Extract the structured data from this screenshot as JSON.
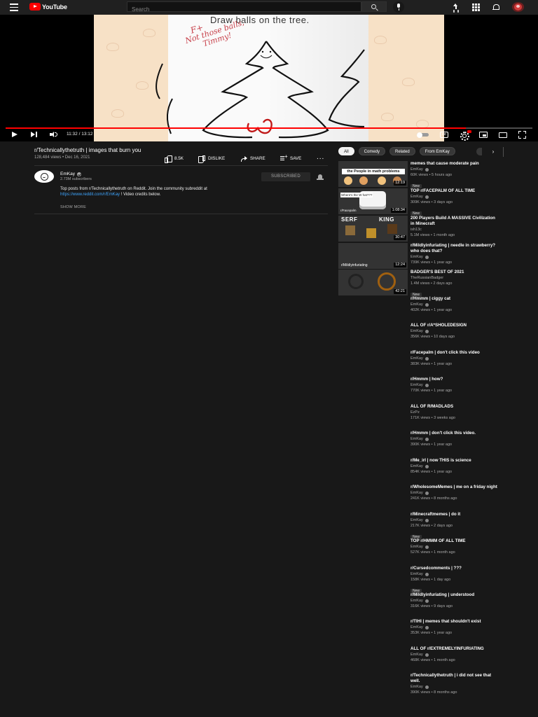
{
  "masthead": {
    "logo_text": "YouTube",
    "search_placeholder": "Search",
    "icons": [
      "menu-icon",
      "youtube-logo-icon",
      "search-icon",
      "mic-icon",
      "upload-icon",
      "apps-icon",
      "notifications-icon",
      "account-avatar"
    ]
  },
  "player": {
    "frame_caption": "Draw balls on the tree.",
    "frame_note_grade": "F+",
    "frame_note": "Not those balls, Timmy!",
    "time_display": "11:32 / 13:12",
    "progress": 0.874,
    "progress_color": "#ff0000",
    "controls": [
      "play-icon",
      "next-icon",
      "volume-icon",
      "autoplay-toggle",
      "subtitles-icon",
      "settings-icon",
      "miniplayer-icon",
      "theater-icon",
      "fullscreen-icon"
    ]
  },
  "video": {
    "title": "r/Technicallythetruth | images that burn you",
    "meta": "128,484 views • Dec 16, 2021",
    "like_count": "8.5K",
    "dislike_label": "DISLIKE",
    "share_label": "SHARE",
    "save_label": "SAVE",
    "more_label": "..."
  },
  "channel": {
    "name": "EmKay",
    "subscribers": "2.73M subscribers",
    "subscribe_label": "SUBSCRIBED",
    "description_line1": "Top posts from r/Technicallythetruth on Reddit. Join the community subreddit at",
    "description_link": "https://www.reddit.com/r/EmKay",
    "description_after_link": " ! Video credits below.",
    "show_more": "SHOW MORE"
  },
  "chips": [
    "All",
    "Comedy",
    "Related",
    "From EmKay"
  ],
  "chip_next": "›",
  "recommendations": [
    {
      "title": "memes that cause moderate pain",
      "channel": "EmKay",
      "meta": "60K views • 5 hours ago",
      "badge": "New",
      "duration": "12:19",
      "thumb_text": "the People in math problems"
    },
    {
      "title": "TOP r/FACEPALM OF ALL TIME",
      "channel": "EmKay",
      "meta": "309K views • 3 days ago",
      "badge": "New",
      "duration": "1:08:34",
      "thumb_text": "Where's the W hat???",
      "thumb_text2": "r/Facepalm"
    },
    {
      "title": "200 Players Build A MASSIVE Civilization in Minecraft",
      "channel": "ish13c",
      "meta": "5.1M views • 1 month ago",
      "badge": "",
      "duration": "30:47",
      "thumb_text": "SERF",
      "thumb_text2": "KING"
    },
    {
      "title": "r/Mildlyinfuriating | needle in strawberry? who does that?",
      "channel": "EmKay",
      "meta": "739K views • 1 year ago",
      "badge": "",
      "duration": "12:24",
      "thumb_text": "r/Mildlyinfuriating"
    },
    {
      "title": "BADGER'S BEST OF 2021",
      "channel": "TheRussianBadger",
      "meta": "1.4M views • 2 days ago",
      "badge": "New",
      "duration": "42:21"
    },
    {
      "title": "r/Hmmm | ciggy cat",
      "channel": "EmKay",
      "meta": "402K views • 1 year ago",
      "badge": ""
    },
    {
      "title": "ALL OF r/A*SHOLEDESIGN",
      "channel": "EmKay",
      "meta": "356K views • 10 days ago",
      "badge": ""
    },
    {
      "title": "r/Facepalm | don't click this video",
      "channel": "EmKay",
      "meta": "383K views • 1 year ago",
      "badge": ""
    },
    {
      "title": "r/Hmmm | how?",
      "channel": "EmKay",
      "meta": "770K views • 1 year ago",
      "badge": ""
    },
    {
      "title": "ALL OF R/MADLADS",
      "channel": "EzPz",
      "meta": "171K views • 3 weeks ago",
      "badge": ""
    },
    {
      "title": "r/Hmmm | don't click this video.",
      "channel": "EmKay",
      "meta": "390K views • 1 year ago",
      "badge": ""
    },
    {
      "title": "r/Me_irl | now THIS is science",
      "channel": "EmKay",
      "meta": "854K views • 1 year ago",
      "badge": ""
    },
    {
      "title": "r/WholesomeMemes | me on a friday night",
      "channel": "EmKay",
      "meta": "241K views • 8 months ago",
      "badge": ""
    },
    {
      "title": "r/Minecraftmemes | do it",
      "channel": "EmKay",
      "meta": "217K views • 2 days ago",
      "badge": "New"
    },
    {
      "title": "TOP r/HMMM OF ALL TIME",
      "channel": "EmKay",
      "meta": "527K views • 1 month ago",
      "badge": ""
    },
    {
      "title": "r/Cursedcomments | ???",
      "channel": "EmKay",
      "meta": "158K views • 1 day ago",
      "badge": "New"
    },
    {
      "title": "r/Mildlyinfuriating | understood",
      "channel": "EmKay",
      "meta": "316K views • 9 days ago",
      "badge": ""
    },
    {
      "title": "r/TIHI | memes that shouldn't exist",
      "channel": "EmKay",
      "meta": "353K views • 1 year ago",
      "badge": ""
    },
    {
      "title": "ALL OF r/EXTREMELYINFURIATING",
      "channel": "EmKay",
      "meta": "468K views • 1 month ago",
      "badge": ""
    },
    {
      "title": "r/Technicallythetruth | i did not see that well.",
      "channel": "EmKay",
      "meta": "390K views • 8 months ago",
      "badge": ""
    }
  ]
}
